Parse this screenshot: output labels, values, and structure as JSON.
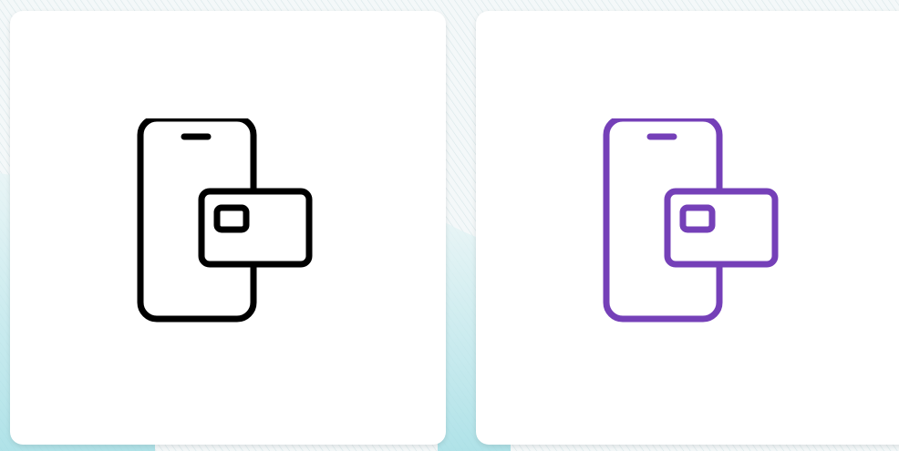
{
  "cards": [
    {
      "icon": "phone-card-payment-icon",
      "color": "#000000"
    },
    {
      "icon": "phone-card-payment-icon",
      "color": "#7540b8"
    }
  ],
  "background": {
    "base": "#f4f8f9",
    "line_color": "#cfe3e6",
    "accent": "#7fd3dc"
  }
}
